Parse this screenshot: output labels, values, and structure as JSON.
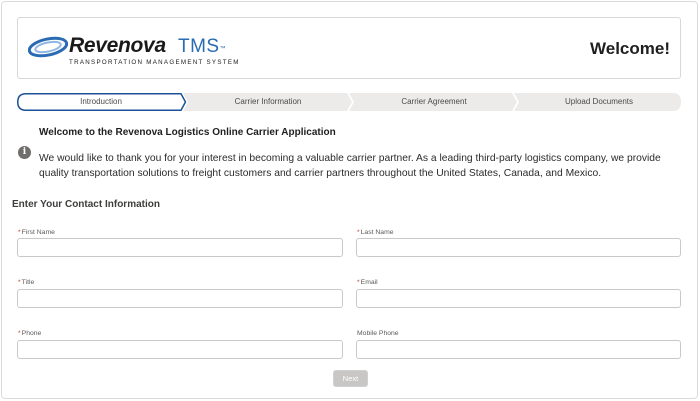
{
  "header": {
    "logo_word": "Revenova",
    "logo_tms": "TMS",
    "logo_trademark": "™",
    "logo_subtitle": "TRANSPORTATION MANAGEMENT SYSTEM",
    "title": "Welcome!"
  },
  "path": {
    "steps": [
      {
        "label": "Introduction",
        "state": "current"
      },
      {
        "label": "Carrier Information",
        "state": "incomplete"
      },
      {
        "label": "Carrier Agreement",
        "state": "incomplete"
      },
      {
        "label": "Upload Documents",
        "state": "incomplete"
      }
    ]
  },
  "intro": {
    "icon": "info-icon",
    "title": "Welcome to the Revenova Logistics Online Carrier Application",
    "body": "We would like to thank you for your interest in becoming a valuable carrier partner. As a leading third-party logistics company, we provide quality transportation solutions to freight customers and carrier partners throughout the United States, Canada, and Mexico."
  },
  "form": {
    "section_title": "Enter Your Contact Information",
    "required_marker": "*",
    "fields": {
      "first_name": {
        "label": "First Name",
        "required": true,
        "value": ""
      },
      "last_name": {
        "label": "Last Name",
        "required": true,
        "value": ""
      },
      "title": {
        "label": "Title",
        "required": true,
        "value": ""
      },
      "email": {
        "label": "Email",
        "required": true,
        "value": ""
      },
      "phone": {
        "label": "Phone",
        "required": true,
        "value": ""
      },
      "mobile_phone": {
        "label": "Mobile Phone",
        "required": false,
        "value": ""
      }
    },
    "next_label": "Next"
  },
  "colors": {
    "brand_blue": "#2a6bb3",
    "path_current_border": "#1b5297",
    "path_step_fill": "#ecebea",
    "required_red": "#c23934",
    "disabled_button": "#c9c7c5"
  }
}
